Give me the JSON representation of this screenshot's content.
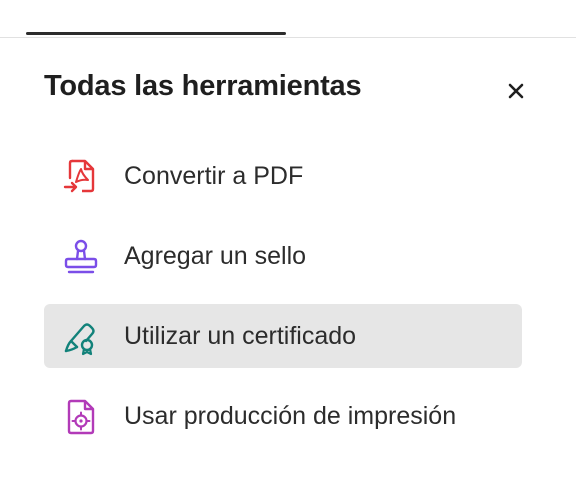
{
  "top_bar": {
    "cut_text": ""
  },
  "panel": {
    "title": "Todas las herramientas",
    "close_symbol": "×"
  },
  "tools": [
    {
      "label": "Convertir a PDF",
      "icon": "convert-to-pdf-icon",
      "color": "#e5373a",
      "selected": false
    },
    {
      "label": "Agregar un sello",
      "icon": "stamp-icon",
      "color": "#7b4ee8",
      "selected": false
    },
    {
      "label": "Utilizar un certificado",
      "icon": "certificate-icon",
      "color": "#12827a",
      "selected": true
    },
    {
      "label": "Usar producción de impresión",
      "icon": "print-production-icon",
      "color": "#b23ab8",
      "selected": false
    }
  ]
}
